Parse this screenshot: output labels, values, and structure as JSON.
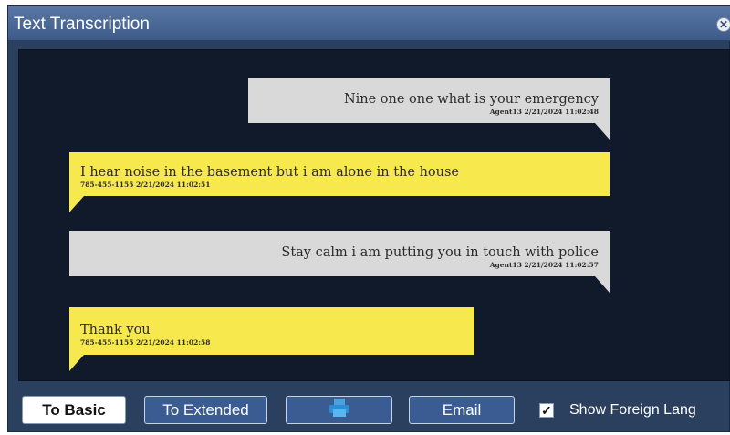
{
  "window": {
    "title": "Text Transcription",
    "close_icon": "close-icon"
  },
  "messages": [
    {
      "sender": "agent",
      "text": "Nine one one what is your emergency",
      "meta": "Agent13 2/21/2024 11:02:48"
    },
    {
      "sender": "caller",
      "text": "I hear noise in the basement but i am alone in the house",
      "meta": "785-455-1155 2/21/2024 11:02:51"
    },
    {
      "sender": "agent",
      "text": "Stay calm i am putting you in touch with police",
      "meta": "Agent13 2/21/2024 11:02:57"
    },
    {
      "sender": "caller",
      "text": "Thank you",
      "meta": "785-455-1155 2/21/2024 11:02:58"
    }
  ],
  "footer": {
    "to_basic": "To Basic",
    "to_extended": "To Extended",
    "print_icon": "printer-icon",
    "email": "Email",
    "show_foreign_checked": true,
    "show_foreign_label": "Show Foreign Lang"
  },
  "colors": {
    "agent_bubble": "#d9d9d9",
    "caller_bubble": "#f7e94d",
    "transcript_bg": "#111a2b",
    "window_bg": "#2b3f5e"
  }
}
